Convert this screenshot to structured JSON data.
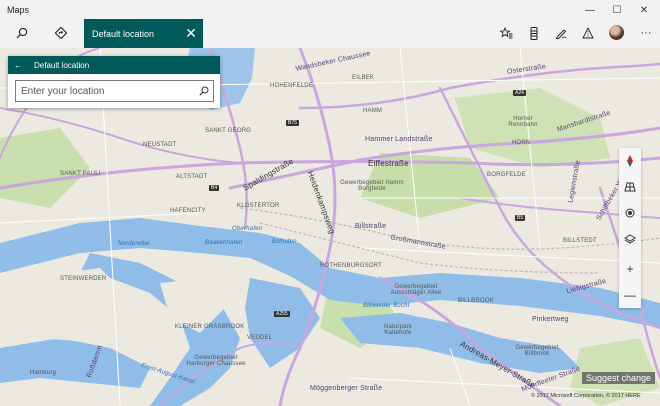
{
  "app": {
    "title": "Maps"
  },
  "window": {
    "minimize": "—",
    "maximize": "☐",
    "close": "✕"
  },
  "toolbar": {
    "search_icon": "search-icon",
    "directions_icon": "directions-icon",
    "tab_label": "Default location",
    "tab_close": "✕",
    "favorites_icon": "favorites-icon",
    "collections_icon": "collections-icon",
    "ink_icon": "ink-icon",
    "traffic_icon": "traffic-icon",
    "more_label": "···"
  },
  "panel": {
    "title": "Default location",
    "back_label": "←",
    "search": {
      "placeholder": "Enter your location",
      "value": ""
    }
  },
  "map": {
    "labels": [
      {
        "text": "Wandsbeker Chaussee",
        "cls": "road"
      },
      {
        "text": "EILBEK",
        "cls": ""
      },
      {
        "text": "Osterstraße",
        "cls": "road"
      },
      {
        "text": "HOHENFELDE",
        "cls": ""
      },
      {
        "text": "A24",
        "cls": "road"
      },
      {
        "text": "HAMM",
        "cls": ""
      },
      {
        "text": "SANKT GEORG",
        "cls": ""
      },
      {
        "text": "Hammer Landstraße",
        "cls": "road"
      },
      {
        "text": "Horner Rennbahn",
        "cls": ""
      },
      {
        "text": "Manshardtstraße",
        "cls": "road"
      },
      {
        "text": "NEUSTADT",
        "cls": ""
      },
      {
        "text": "Eiffestraße",
        "cls": "road big"
      },
      {
        "text": "HORN",
        "cls": ""
      },
      {
        "text": "SANKT PAULI",
        "cls": ""
      },
      {
        "text": "ALTSTADT",
        "cls": ""
      },
      {
        "text": "Spaldingstraße",
        "cls": "road big"
      },
      {
        "text": "Heidenkampsweg",
        "cls": "road big"
      },
      {
        "text": "BORGFELDE",
        "cls": ""
      },
      {
        "text": "Legienstraße",
        "cls": "road"
      },
      {
        "text": "Schiffbeker Weg",
        "cls": "road"
      },
      {
        "text": "Gewerbegebiet Hamm Borgfelde",
        "cls": ""
      },
      {
        "text": "KLOSTERTOR",
        "cls": ""
      },
      {
        "text": "HAFENCITY",
        "cls": ""
      },
      {
        "text": "Billstraße",
        "cls": "road"
      },
      {
        "text": "Norderelbe",
        "cls": "water"
      },
      {
        "text": "Baakenhafen",
        "cls": "water"
      },
      {
        "text": "Oberhafen",
        "cls": "water"
      },
      {
        "text": "Billhafen",
        "cls": "water"
      },
      {
        "text": "Großmannstraße",
        "cls": "road"
      },
      {
        "text": "BILLSTEDT",
        "cls": ""
      },
      {
        "text": "STEINWERDER",
        "cls": ""
      },
      {
        "text": "ROTHENBURGSORT",
        "cls": ""
      },
      {
        "text": "Gewerbegebiet Ausschläger Allee",
        "cls": ""
      },
      {
        "text": "Liebigstraße",
        "cls": "road"
      },
      {
        "text": "Billwerder Bucht",
        "cls": "water"
      },
      {
        "text": "BILLBROOK",
        "cls": ""
      },
      {
        "text": "Pinkertweg",
        "cls": "road"
      },
      {
        "text": "Naturpark Kaltehofe",
        "cls": ""
      },
      {
        "text": "KLEINER GRASBROOK",
        "cls": ""
      },
      {
        "text": "VEDDEL",
        "cls": ""
      },
      {
        "text": "Gewerbegebiet Harburger Chaussee",
        "cls": ""
      },
      {
        "text": "Andreas-Meyer-Straße",
        "cls": "road big"
      },
      {
        "text": "Gewerbegebiet Billbrook",
        "cls": ""
      },
      {
        "text": "Roßdamm",
        "cls": "road"
      },
      {
        "text": "Ernst-August-Kanal",
        "cls": "water"
      },
      {
        "text": "Moorfleeter Straße",
        "cls": "road"
      },
      {
        "text": "Möggenberger Straße",
        "cls": "road"
      },
      {
        "text": "Hamburg",
        "cls": ""
      }
    ],
    "shields": [
      "B75",
      "B4",
      "B5",
      "A24",
      "A255"
    ]
  },
  "controls": {
    "compass": "compass-icon",
    "tilt": "tilt-icon",
    "locate": "locate-icon",
    "layers": "layers-icon",
    "zoom_in": "+",
    "zoom_out": "—"
  },
  "footer": {
    "suggest": "Suggest change",
    "copyright": "© 2017 Microsoft Corporation, © 2017 HERE"
  }
}
